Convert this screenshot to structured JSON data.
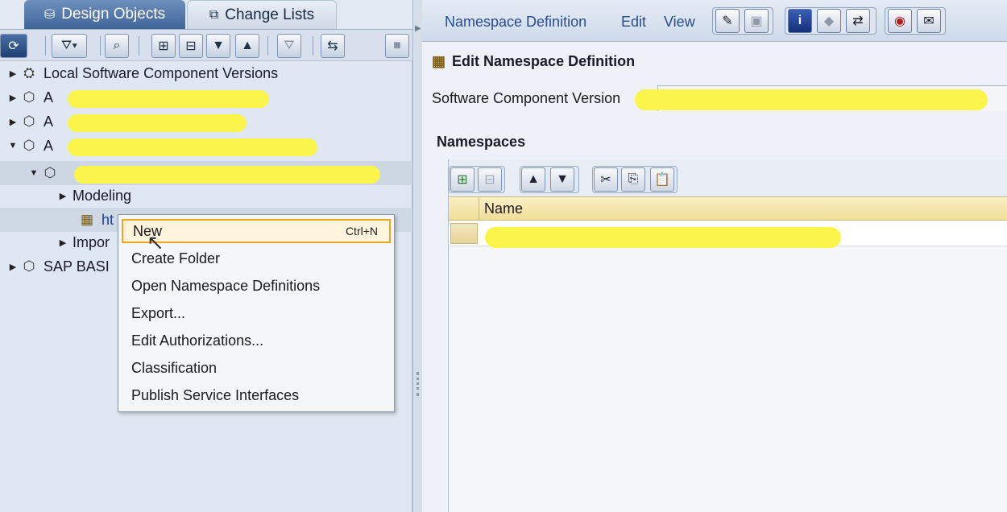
{
  "left_tabs": {
    "design_objects": "Design Objects",
    "change_lists": "Change Lists"
  },
  "tree": {
    "local_scv": "Local Software Component Versions",
    "item_a1": "A",
    "item_a2": "A",
    "item_a3": "A",
    "modeling": "Modeling",
    "url_prefix": "ht",
    "imported": "Impor",
    "sap_basis": "SAP BASI"
  },
  "context_menu": {
    "items": [
      {
        "label": "New",
        "shortcut": "Ctrl+N"
      },
      {
        "label": "Create Folder"
      },
      {
        "label": "Open Namespace Definitions"
      },
      {
        "label": "Export..."
      },
      {
        "label": "Edit Authorizations..."
      },
      {
        "label": "Classification"
      },
      {
        "label": "Publish Service Interfaces"
      }
    ]
  },
  "right_menu": {
    "namespace_definition": "Namespace Definition",
    "edit": "Edit",
    "view": "View"
  },
  "form": {
    "title": "Edit Namespace Definition",
    "scv_label": "Software Component Version",
    "namespaces_label": "Namespaces",
    "column_name": "Name"
  },
  "colors": {
    "highlight": "#fbf44b",
    "menu_focus": "#f0a623",
    "tab_active": "#3f6598"
  }
}
